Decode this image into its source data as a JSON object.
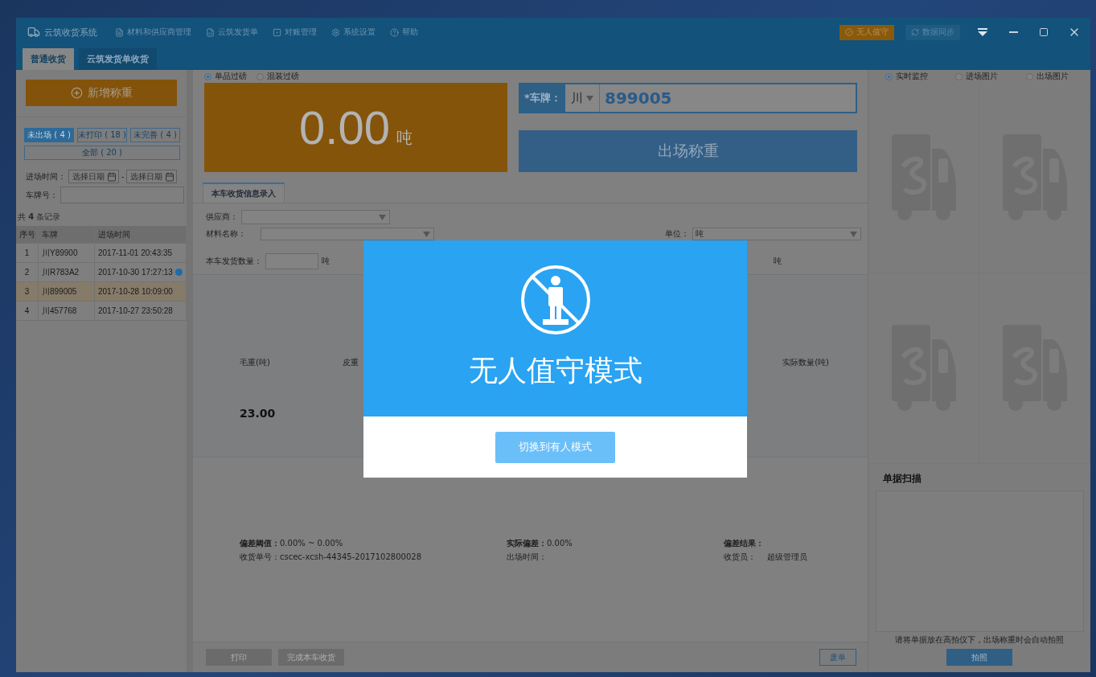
{
  "app": {
    "title": "云筑收货系统",
    "menu": [
      {
        "label": "材料和供应商管理",
        "kind": "list"
      },
      {
        "label": "云筑发货单",
        "kind": "doc"
      },
      {
        "label": "对账管理",
        "kind": "ledger"
      },
      {
        "label": "系统设置",
        "kind": "settings"
      },
      {
        "label": "帮助",
        "kind": "help"
      }
    ],
    "unattended_button": "无人值守",
    "sync_button": "数据同步"
  },
  "tabs": [
    {
      "label": "普通收货",
      "selected": true
    },
    {
      "label": "云筑发货单收货",
      "selected": false
    }
  ],
  "left": {
    "add_button": "新增称重",
    "filters": [
      {
        "label": "未出场 ( 4 )",
        "selected": true
      },
      {
        "label": "未打印 ( 18 )",
        "selected": false
      },
      {
        "label": "未完善 ( 4 )",
        "selected": false
      },
      {
        "label": "全部 ( 20 )",
        "selected": false
      }
    ],
    "date_label": "进场时间：",
    "date_from": {
      "placeholder": "选择日期"
    },
    "date_separator": "-",
    "date_to": {
      "placeholder": "选择日期"
    },
    "plate_label": "车牌号：",
    "record_count": "共 **4** 条记录",
    "columns": [
      "序号",
      "车牌",
      "进场时间"
    ],
    "rows": [
      {
        "index": "1",
        "plate": "川Y89900",
        "time": "2017-11-01 20:43:35",
        "selected": false,
        "flagged": false
      },
      {
        "index": "2",
        "plate": "川R783A2",
        "time": "2017-10-30 17:27:13",
        "selected": false,
        "flagged": true
      },
      {
        "index": "3",
        "plate": "川899005",
        "time": "2017-10-28 10:09:00",
        "selected": true,
        "flagged": false
      },
      {
        "index": "4",
        "plate": "川457768",
        "time": "2017-10-27 23:50:28",
        "selected": false,
        "flagged": false
      }
    ]
  },
  "center": {
    "weigh_modes": [
      {
        "label": "单品过磅",
        "selected": true
      },
      {
        "label": "混装过磅",
        "selected": false
      }
    ],
    "weight": {
      "value": "0.00",
      "unit": "吨"
    },
    "plate": {
      "label": "*车牌：",
      "province": "川",
      "value": "899005"
    },
    "exit_button": "出场称重",
    "form_tab": "本车收货信息录入",
    "supplier_label": "供应商：",
    "material_label": "材料名称：",
    "unit_label": "单位：",
    "unit_value": "吨",
    "quantity_label": "本车发货数量：",
    "quantity_unit": "吨",
    "quantity_unit_right": "吨",
    "weight_columns": [
      "毛重(吨)",
      "皮重",
      "实际数量(吨)"
    ],
    "gross_weight": "23.00",
    "summary": [
      [
        "**偏差阈值：**0.00% ~ 0.00%",
        "收货单号：cscec-xcsh-44345-2017102800028"
      ],
      [
        "**实际偏差：**0.00%",
        "出场时间："
      ],
      [
        "**偏差结果：**",
        "收货员："
      ]
    ],
    "receiver": "超级管理员",
    "buttons": [
      {
        "label": "打印",
        "disabled": true,
        "kind": "fill"
      },
      {
        "label": "完成本车收货",
        "disabled": true,
        "kind": "fill"
      },
      {
        "label": "废单",
        "disabled": false,
        "kind": "outline"
      }
    ]
  },
  "right": {
    "camera_modes": [
      {
        "label": "实时监控",
        "selected": true
      },
      {
        "label": "进场图片",
        "selected": false
      },
      {
        "label": "出场图片",
        "selected": false
      }
    ],
    "scan_title": "单据扫描",
    "scan_hint": "请将单据放在高拍仪下，出场称重时会自动拍照",
    "photo_button": "拍照"
  },
  "modal": {
    "title": "无人值守模式",
    "switch_button": "切换到有人模式"
  }
}
